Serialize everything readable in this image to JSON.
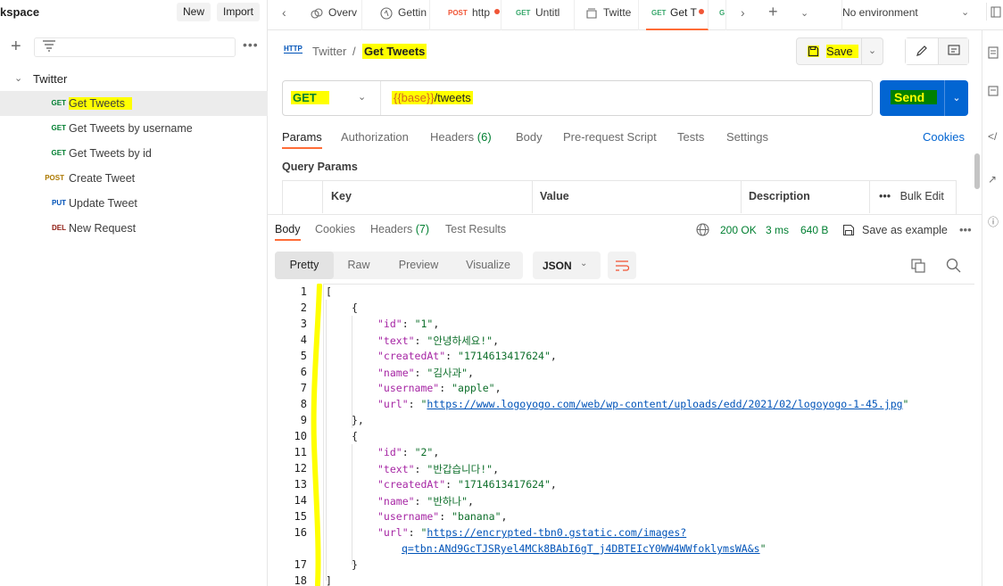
{
  "sidebar": {
    "workspace_name": "kspace",
    "new_label": "New",
    "import_label": "Import",
    "more_label": "•••",
    "collection": "Twitter",
    "items": [
      {
        "method": "GET",
        "label": "Get Tweets"
      },
      {
        "method": "GET",
        "label": "Get Tweets by username"
      },
      {
        "method": "GET",
        "label": "Get Tweets by id"
      },
      {
        "method": "POST",
        "label": "Create Tweet"
      },
      {
        "method": "PUT",
        "label": "Update Tweet"
      },
      {
        "method": "DEL",
        "label": "New Request"
      }
    ]
  },
  "tabs": [
    {
      "method": "",
      "label": "Overv",
      "icon": "overview-icon"
    },
    {
      "method": "",
      "label": "Gettin",
      "icon": "getting-started-icon"
    },
    {
      "method": "POST",
      "label": "http"
    },
    {
      "method": "GET",
      "label": "Untitl"
    },
    {
      "method": "",
      "label": "Twitte",
      "icon": "collection-icon"
    },
    {
      "method": "GET",
      "label": "Get T"
    },
    {
      "method": "G",
      "label": ""
    }
  ],
  "environment": "No environment",
  "breadcrumb": {
    "icon_label": "HTTP",
    "collection": "Twitter",
    "separator": "/",
    "request": "Get Tweets"
  },
  "save_label": "Save",
  "request": {
    "method": "GET",
    "url_var": "{{base}}",
    "url_path": "/tweets",
    "send_label": "Send"
  },
  "request_tabs": [
    {
      "label": "Params",
      "count": ""
    },
    {
      "label": "Authorization",
      "count": ""
    },
    {
      "label": "Headers",
      "count": "(6)"
    },
    {
      "label": "Body",
      "count": ""
    },
    {
      "label": "Pre-request Script",
      "count": ""
    },
    {
      "label": "Tests",
      "count": ""
    },
    {
      "label": "Settings",
      "count": ""
    }
  ],
  "cookies_link": "Cookies",
  "query_params": {
    "title": "Query Params",
    "headers": [
      "Key",
      "Value",
      "Description"
    ],
    "bulk_edit": "Bulk Edit",
    "more": "•••"
  },
  "response": {
    "tabs": [
      {
        "label": "Body",
        "count": ""
      },
      {
        "label": "Cookies",
        "count": ""
      },
      {
        "label": "Headers",
        "count": "(7)"
      },
      {
        "label": "Test Results",
        "count": ""
      }
    ],
    "status": "200 OK",
    "time": "3 ms",
    "size": "640 B",
    "save_example": "Save as example",
    "more": "•••",
    "formats": [
      "Pretty",
      "Raw",
      "Preview",
      "Visualize"
    ],
    "language": "JSON",
    "line_numbers": [
      "1",
      "2",
      "3",
      "4",
      "5",
      "6",
      "7",
      "8",
      "9",
      "10",
      "11",
      "12",
      "13",
      "14",
      "15",
      "16",
      "",
      "17",
      "18"
    ],
    "tweets": [
      {
        "id": "\"1\"",
        "text": "\"안녕하세요!\"",
        "createdAt": "\"1714613417624\"",
        "name": "\"김사과\"",
        "username": "\"apple\"",
        "url": "https://www.logoyogo.com/web/wp-content/uploads/edd/2021/02/logoyogo-1-45.jpg"
      },
      {
        "id": "\"2\"",
        "text": "\"반갑습니다!\"",
        "createdAt": "\"1714613417624\"",
        "name": "\"반하나\"",
        "username": "\"banana\"",
        "url_line1": "https://encrypted-tbn0.gstatic.com/images?",
        "url_line2": "q=tbn:ANd9GcTJSRyel4MCk8BAbI6gT_j4DBTEIcY0WW4WWfoklymsWA&s"
      }
    ]
  },
  "colors": {
    "accent": "#ff6c37",
    "send_blue": "#0265d2",
    "highlight": "#ffff00",
    "get": "#007f31"
  }
}
